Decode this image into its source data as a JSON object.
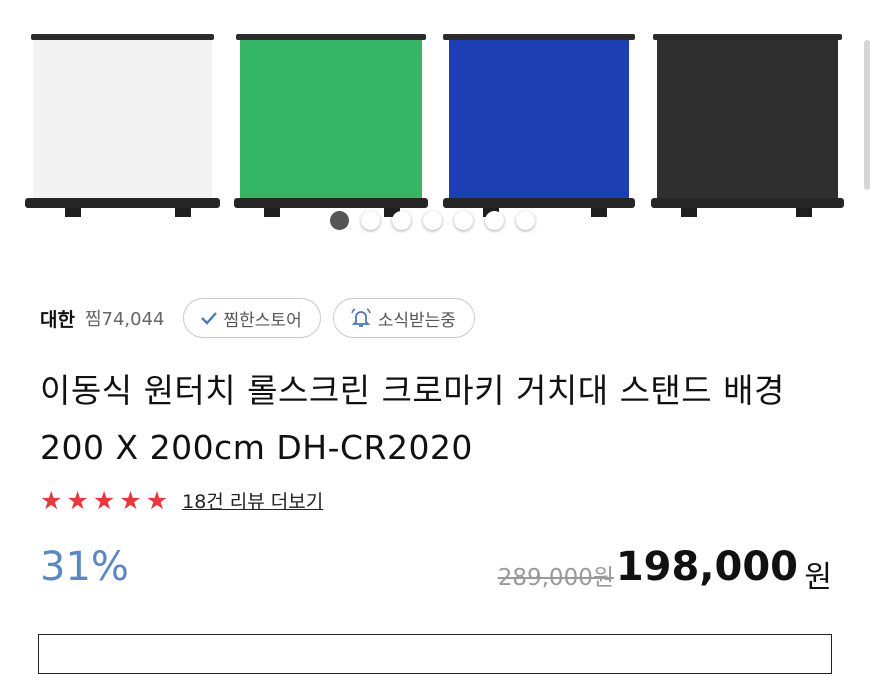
{
  "gallery": {
    "images": [
      {
        "name": "white-screen",
        "color": "#f3f3f3"
      },
      {
        "name": "green-screen",
        "color": "#35b566"
      },
      {
        "name": "blue-screen",
        "color": "#1e3fb4"
      },
      {
        "name": "black-screen",
        "color": "#2f2f2f"
      }
    ],
    "dot_count": 7,
    "active_dot": 1
  },
  "store": {
    "name": "대한",
    "fav_count": "찜74,044",
    "follow_label": "찜한스토어",
    "alarm_label": "소식받는중",
    "follow_icon": "check-icon",
    "alarm_icon": "bell-icon"
  },
  "product": {
    "title": "이동식 원터치 롤스크린 크로마키 거치대 스탠드 배경 200 X 200cm DH-CR2020",
    "rating": {
      "stars": 5,
      "star_color": "#e8373d"
    },
    "review_link": "18건 리뷰 더보기"
  },
  "price": {
    "discount": "31%",
    "original": "289,000원",
    "sale": "198,000",
    "unit": "원",
    "discount_color": "#5b87c2"
  }
}
